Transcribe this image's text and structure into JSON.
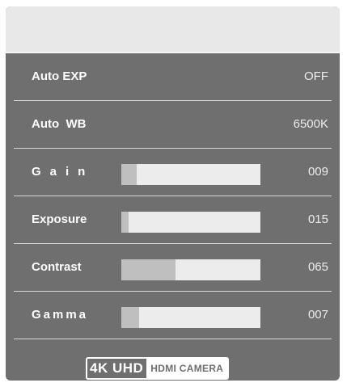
{
  "menu": {
    "rows": [
      {
        "label": "Auto EXP",
        "value": "OFF"
      },
      {
        "label": "Auto  WB",
        "value": "6500K"
      },
      {
        "label": "Gain",
        "value": "009",
        "level_percent": 11
      },
      {
        "label": "Exposure",
        "value": "015",
        "level_percent": 5
      },
      {
        "label": "Contrast",
        "value": "065",
        "level_percent": 39
      },
      {
        "label": "Gamma",
        "value": "007",
        "level_percent": 13
      }
    ]
  },
  "branding": {
    "main": "4K UHD",
    "sub": "HDMI CAMERA"
  },
  "colors": {
    "panel": "#6f6f6f",
    "header": "#e8e8e8",
    "track": "#ececec",
    "fill": "#bfbfbf"
  }
}
